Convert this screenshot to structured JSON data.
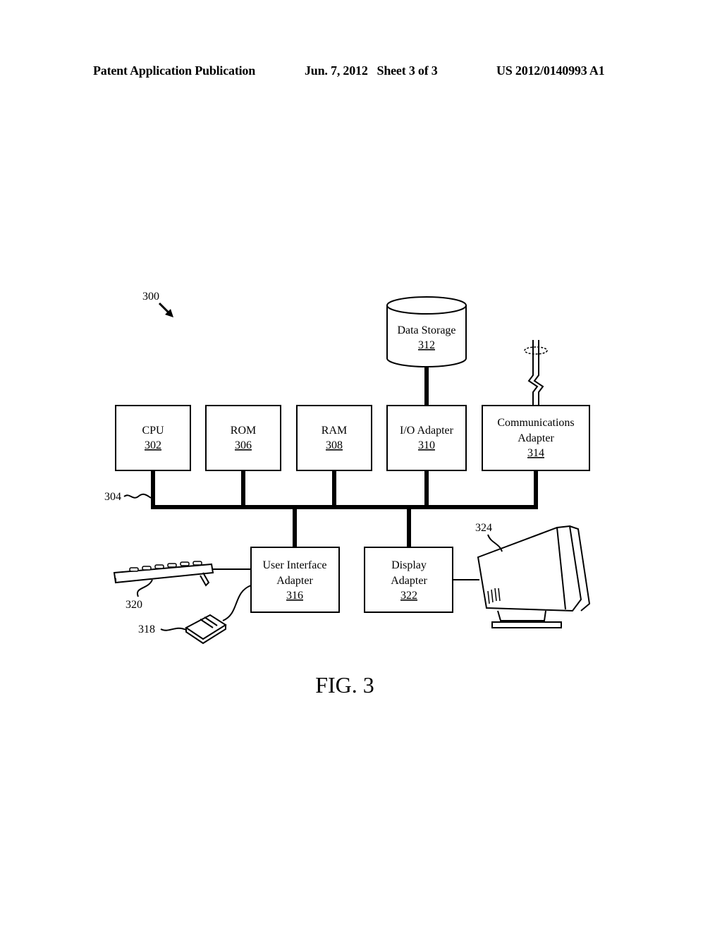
{
  "header": {
    "left": "Patent Application Publication",
    "middle": "Jun. 7, 2012   Sheet 3 of 3",
    "right": "US 2012/0140993 A1"
  },
  "figure": {
    "reference": "300",
    "bus_reference": "304",
    "caption": "FIG. 3",
    "blocks": [
      {
        "label": "CPU",
        "ref": "302"
      },
      {
        "label": "ROM",
        "ref": "306"
      },
      {
        "label": "RAM",
        "ref": "308"
      },
      {
        "label": "I/O Adapter",
        "ref": "310"
      },
      {
        "label_lines": [
          "Communications",
          "Adapter"
        ],
        "ref": "314"
      },
      {
        "label_lines": [
          "User Interface",
          "Adapter"
        ],
        "ref": "316"
      },
      {
        "label_lines": [
          "Display",
          "Adapter"
        ],
        "ref": "322"
      }
    ],
    "data_storage": {
      "label": "Data Storage",
      "ref": "312"
    },
    "peripherals": {
      "keyboard_ref": "320",
      "mouse_ref": "318",
      "monitor_ref": "324"
    }
  }
}
